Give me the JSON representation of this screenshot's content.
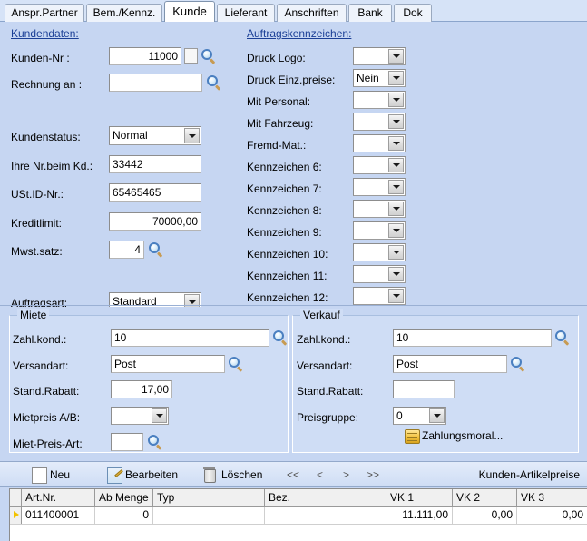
{
  "tabs": [
    {
      "label": "Anspr.Partner",
      "active": false
    },
    {
      "label": "Bem./Kennz.",
      "active": false
    },
    {
      "label": "Kunde",
      "active": true
    },
    {
      "label": "Lieferant",
      "active": false
    },
    {
      "label": "Anschriften",
      "active": false
    },
    {
      "label": "Bank",
      "active": false
    },
    {
      "label": "Dok",
      "active": false
    }
  ],
  "customer_section": {
    "title": "Kundendaten:",
    "fields": {
      "kunden_nr_label": "Kunden-Nr :",
      "kunden_nr_value": "11000",
      "rechnung_an_label": "Rechnung an :",
      "rechnung_an_value": "",
      "kundenstatus_label": "Kundenstatus:",
      "kundenstatus_value": "Normal",
      "ihre_nr_label": "Ihre Nr.beim Kd.:",
      "ihre_nr_value": "33442",
      "ustid_label": "USt.ID-Nr.:",
      "ustid_value": "65465465",
      "kreditlimit_label": "Kreditlimit:",
      "kreditlimit_value": "70000,00",
      "mwst_label": "Mwst.satz:",
      "mwst_value": "4",
      "auftragsart_label": "Auftragsart:",
      "auftragsart_value": "Standard"
    }
  },
  "order_flags_section": {
    "title": "Auftragskennzeichen:",
    "rows": [
      {
        "label": "Druck Logo:",
        "value": ""
      },
      {
        "label": "Druck Einz.preise:",
        "value": "Nein"
      },
      {
        "label": "Mit Personal:",
        "value": ""
      },
      {
        "label": "Mit Fahrzeug:",
        "value": ""
      },
      {
        "label": "Fremd-Mat.:",
        "value": ""
      },
      {
        "label": "Kennzeichen 6:",
        "value": ""
      },
      {
        "label": "Kennzeichen 7:",
        "value": ""
      },
      {
        "label": "Kennzeichen 8:",
        "value": ""
      },
      {
        "label": "Kennzeichen 9:",
        "value": ""
      },
      {
        "label": "Kennzeichen 10:",
        "value": ""
      },
      {
        "label": "Kennzeichen 11:",
        "value": ""
      },
      {
        "label": "Kennzeichen 12:",
        "value": ""
      }
    ]
  },
  "miete_group": {
    "title": "Miete",
    "zahl_kond_label": "Zahl.kond.:",
    "zahl_kond_value": "10",
    "versandart_label": "Versandart:",
    "versandart_value": "Post",
    "stand_rabatt_label": "Stand.Rabatt:",
    "stand_rabatt_value": "17,00",
    "mietpreis_ab_label": "Mietpreis A/B:",
    "mietpreis_ab_value": "",
    "miet_preis_art_label": "Miet-Preis-Art:",
    "miet_preis_art_value": ""
  },
  "verkauf_group": {
    "title": "Verkauf",
    "zahl_kond_label": "Zahl.kond.:",
    "zahl_kond_value": "10",
    "versandart_label": "Versandart:",
    "versandart_value": "Post",
    "stand_rabatt_label": "Stand.Rabatt:",
    "stand_rabatt_value": "",
    "preisgruppe_label": "Preisgruppe:",
    "preisgruppe_value": "0",
    "zahlungsmoral_label": "Zahlungsmoral..."
  },
  "toolbar": {
    "neu_label": "Neu",
    "bearbeiten_label": "Bearbeiten",
    "loeschen_label": "Löschen",
    "nav_first": "<<",
    "nav_prev": "<",
    "nav_next": ">",
    "nav_last": ">>",
    "right_title": "Kunden-Artikelpreise"
  },
  "grid": {
    "columns": [
      "Art.Nr.",
      "Ab Menge",
      "Typ",
      "Bez.",
      "VK 1",
      "VK 2",
      "VK 3"
    ],
    "rows": [
      {
        "art_nr": "011400001",
        "ab_menge": "0",
        "typ": "",
        "bez": "",
        "vk1": "11.111,00",
        "vk2": "0,00",
        "vk3": "0,00"
      }
    ]
  },
  "colors": {
    "panel_background": "#c6d6f2",
    "group_background": "#cfddf5",
    "link_blue": "#1b3f96",
    "row_marker": "#f2c200"
  }
}
